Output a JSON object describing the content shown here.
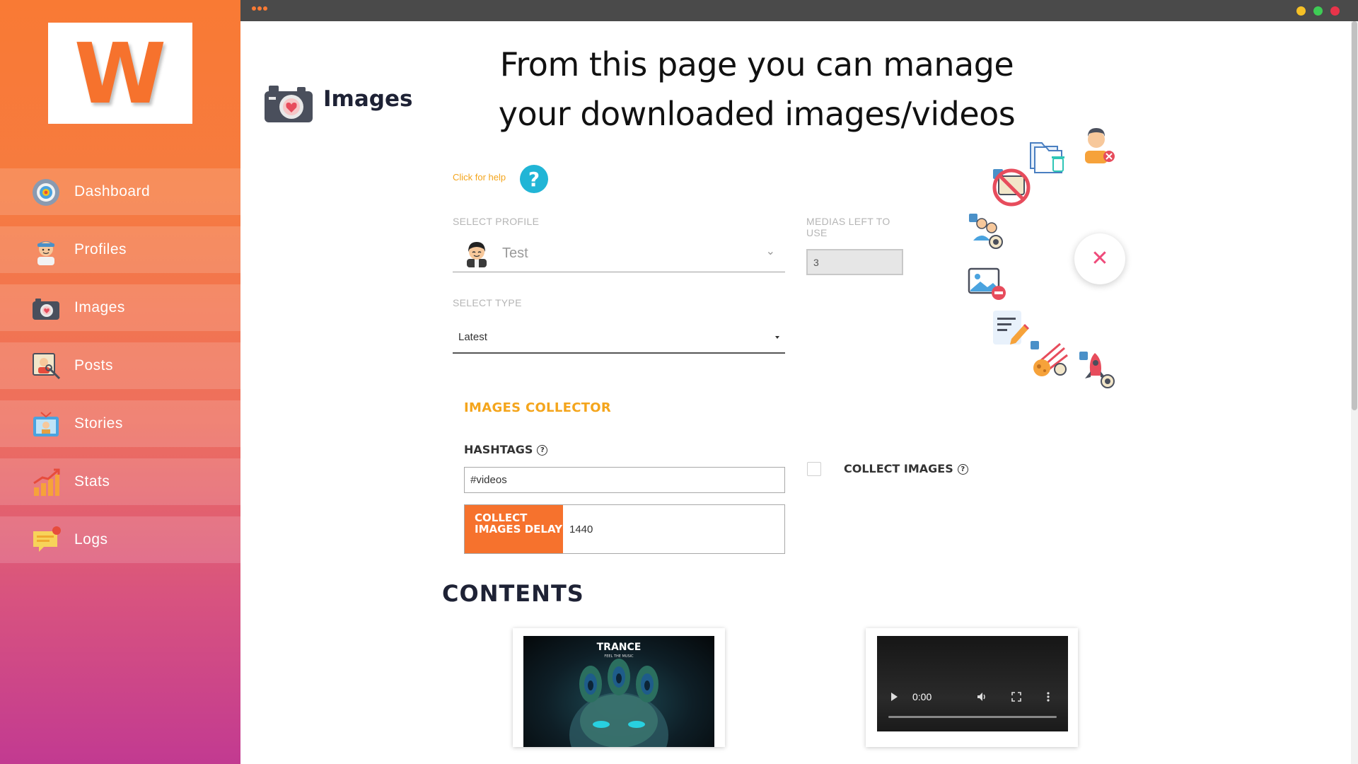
{
  "app": {
    "logo_letter": "W"
  },
  "sidebar": {
    "items": [
      {
        "label": "Dashboard",
        "icon": "dashboard-gauge-icon"
      },
      {
        "label": "Profiles",
        "icon": "profile-avatar-icon"
      },
      {
        "label": "Images",
        "icon": "camera-icon"
      },
      {
        "label": "Posts",
        "icon": "posts-photo-icon"
      },
      {
        "label": "Stories",
        "icon": "stories-icon"
      },
      {
        "label": "Stats",
        "icon": "stats-chart-icon"
      },
      {
        "label": "Logs",
        "icon": "logs-chat-icon"
      }
    ]
  },
  "page": {
    "title": "Images",
    "headline_line1": "From this page you can manage",
    "headline_line2": "your downloaded images/videos",
    "help_text": "Click for help",
    "help_symbol": "?"
  },
  "profile": {
    "label": "SELECT PROFILE",
    "value": "Test",
    "chevron": "⌄"
  },
  "medias_left": {
    "label": "MEDIAS LEFT TO USE",
    "value": "3"
  },
  "type": {
    "label": "SELECT TYPE",
    "value": "Latest"
  },
  "collector": {
    "title": "IMAGES COLLECTOR",
    "hashtags_label": "HASHTAGS",
    "hashtags_value": "#videos",
    "delay_label": "COLLECT IMAGES DELAY",
    "delay_value": "1440",
    "collect_label": "COLLECT IMAGES",
    "info_symbol": "?"
  },
  "contents": {
    "title": "CONTENTS",
    "items": [
      {
        "type": "image",
        "thumb_title": "TRANCE",
        "thumb_sub": "FEEL THE MUSIC"
      },
      {
        "type": "video",
        "time": "0:00"
      }
    ]
  },
  "fab": {
    "close_symbol": "✕"
  },
  "colors": {
    "accent_orange": "#f6722d",
    "accent_yellow": "#f4a51c",
    "help_blue": "#21b5d6",
    "close_pink": "#ef4a7a",
    "topbar": "#4a4a4a"
  }
}
